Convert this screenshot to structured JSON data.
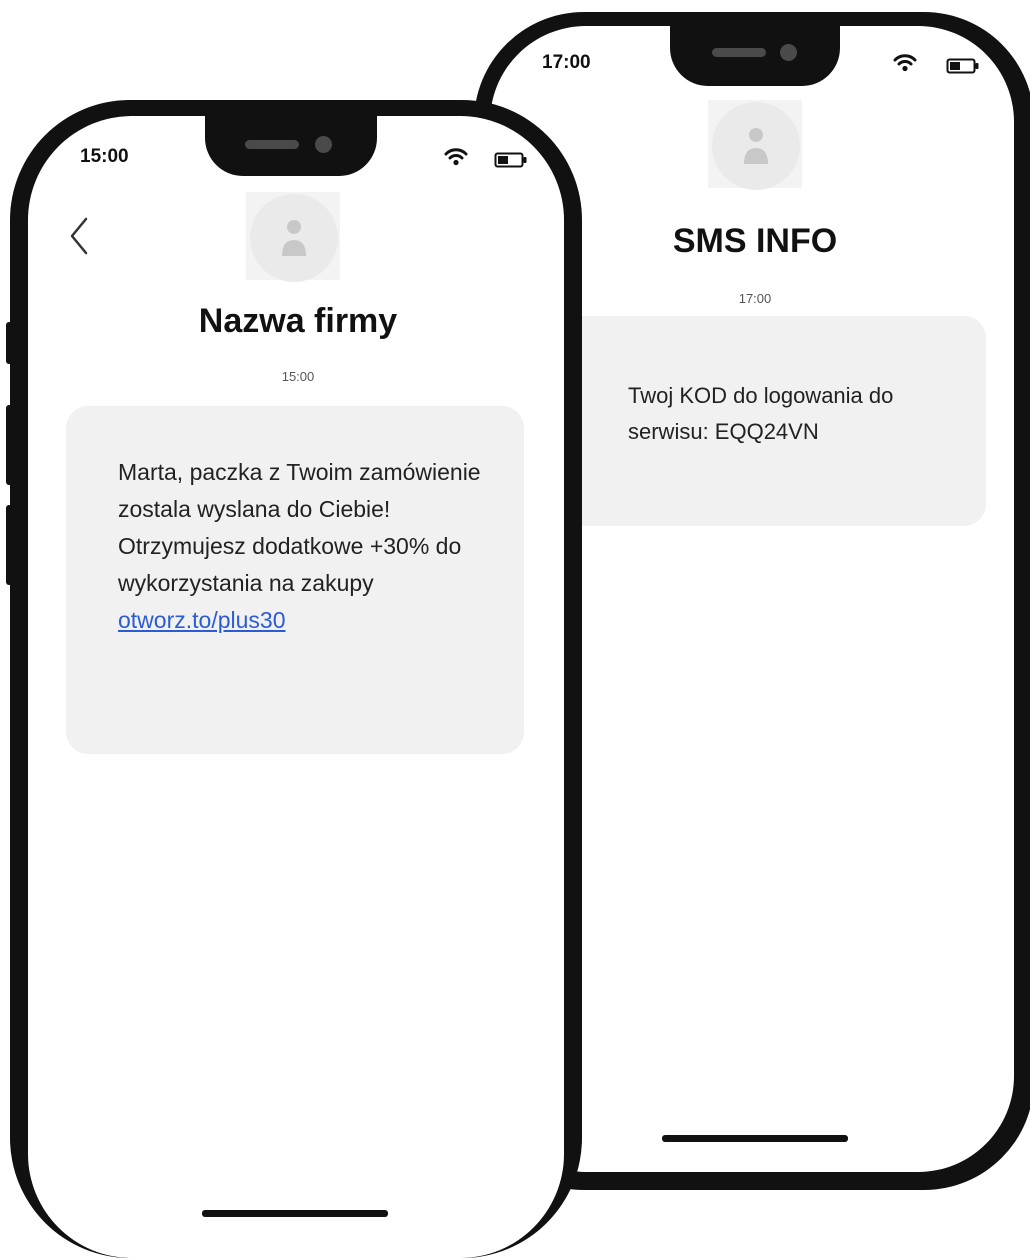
{
  "back_phone": {
    "status_time": "17:00",
    "contact_name": "SMS INFO",
    "timestamp": "17:00",
    "message": "Twoj KOD do logowania do serwisu: EQQ24VN",
    "icons": {
      "wifi": "wifi-icon",
      "battery": "battery-icon",
      "avatar": "person-icon"
    }
  },
  "front_phone": {
    "status_time": "15:00",
    "contact_name": "Nazwa firmy",
    "timestamp": "15:00",
    "message": "Marta, paczka z Twoim zamówienie  zostala wyslana do Ciebie! Otrzymujesz dodatkowe +30% do wykorzystania na zakupy",
    "link": "otworz.to/plus30",
    "icons": {
      "back": "chevron-left-icon",
      "wifi": "wifi-icon",
      "battery": "battery-icon",
      "avatar": "person-icon"
    }
  },
  "colors": {
    "frame": "#111111",
    "bubble": "#f1f1f1",
    "link": "#2b5cd6"
  }
}
